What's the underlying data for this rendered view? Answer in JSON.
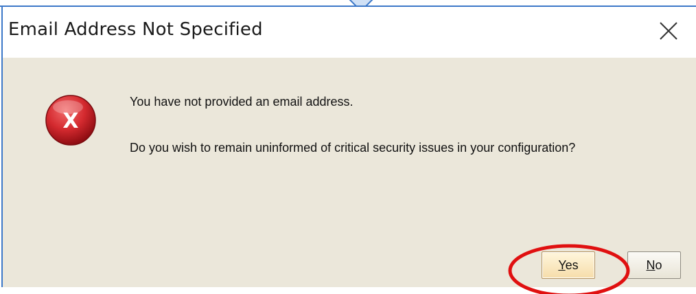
{
  "dialog": {
    "title": "Email Address Not Specified",
    "close_icon": "close-icon",
    "error_icon": "error-x-icon",
    "error_icon_letter": "X",
    "message_line1": "You have not provided an email address.",
    "message_line2": "Do you wish to remain uninformed of critical security issues in your configuration?",
    "buttons": {
      "yes_mnemonic": "Y",
      "yes_rest": "es",
      "no_mnemonic": "N",
      "no_rest": "o"
    }
  },
  "colors": {
    "accent_border": "#3c78c8",
    "body_background": "#ebe7da",
    "error_icon": "#c8202a",
    "annotation_circle": "#e01010",
    "default_button": "#f6ddaa"
  }
}
